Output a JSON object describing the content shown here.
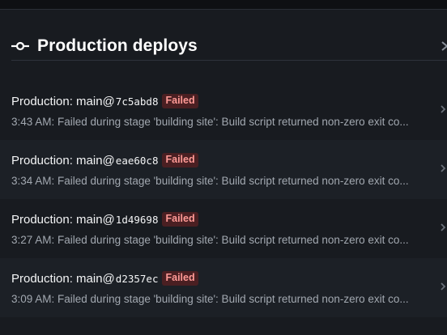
{
  "section": {
    "title": "Production deploys",
    "icon": "commit-icon"
  },
  "deploys": [
    {
      "prefix": "Production: main@",
      "hash": "7c5abd8",
      "status": "Failed",
      "summary": "3:43 AM: Failed during stage 'building site': Build script returned non-zero exit co..."
    },
    {
      "prefix": "Production: main@",
      "hash": "eae60c8",
      "status": "Failed",
      "summary": "3:34 AM: Failed during stage 'building site': Build script returned non-zero exit co..."
    },
    {
      "prefix": "Production: main@",
      "hash": "1d49698",
      "status": "Failed",
      "summary": "3:27 AM: Failed during stage 'building site': Build script returned non-zero exit co..."
    },
    {
      "prefix": "Production: main@",
      "hash": "d2357ec",
      "status": "Failed",
      "summary": "3:09 AM: Failed during stage 'building site': Build script returned non-zero exit co..."
    }
  ],
  "colors": {
    "background": "#181b20",
    "row_alt": "#1c2026",
    "failed_badge_bg": "#4a1f22",
    "failed_badge_text": "#ff9a96"
  }
}
